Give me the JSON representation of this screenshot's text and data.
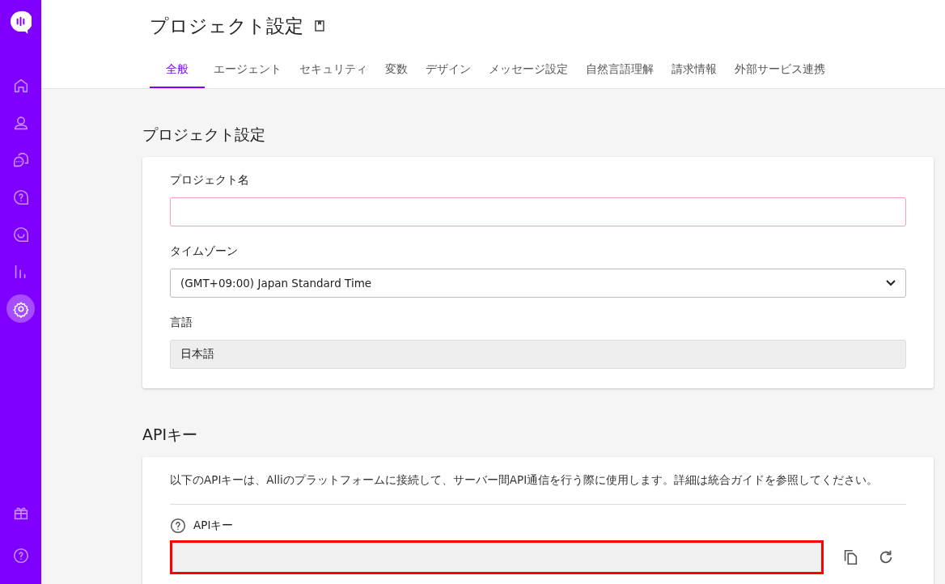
{
  "sidebar": {
    "items": [
      {
        "kind": "home",
        "selected": false
      },
      {
        "kind": "user",
        "selected": false
      },
      {
        "kind": "chat",
        "selected": false
      },
      {
        "kind": "faq",
        "selected": false
      },
      {
        "kind": "smile",
        "selected": false
      },
      {
        "kind": "stats",
        "selected": false
      },
      {
        "kind": "settings",
        "selected": true
      }
    ],
    "bottom_items": [
      {
        "kind": "gift",
        "selected": false
      },
      {
        "kind": "help",
        "selected": false
      }
    ]
  },
  "header": {
    "title": "プロジェクト設定"
  },
  "tabs": [
    {
      "label": "全般",
      "selected": true
    },
    {
      "label": "エージェント",
      "selected": false
    },
    {
      "label": "セキュリティ",
      "selected": false
    },
    {
      "label": "変数",
      "selected": false
    },
    {
      "label": "デザイン",
      "selected": false
    },
    {
      "label": "メッセージ設定",
      "selected": false
    },
    {
      "label": "自然言語理解",
      "selected": false
    },
    {
      "label": "請求情報",
      "selected": false
    },
    {
      "label": "外部サービス連携",
      "selected": false
    }
  ],
  "project_settings": {
    "heading": "プロジェクト設定",
    "fields": [
      {
        "kind": "text",
        "label": "プロジェクト名"
      },
      {
        "kind": "select",
        "label": "タイムゾーン",
        "value": "(GMT+09:00) Japan Standard Time"
      },
      {
        "kind": "readonly",
        "label": "言語",
        "value": "日本語"
      }
    ]
  },
  "api_key": {
    "heading": "APIキー",
    "description": "以下のAPIキーは、Alliのプラットフォームに接続して、サーバー間API通信を行う際に使用します。詳細は統合ガイドを参照してください。",
    "field_label": "APIキー",
    "highlighted": true
  }
}
